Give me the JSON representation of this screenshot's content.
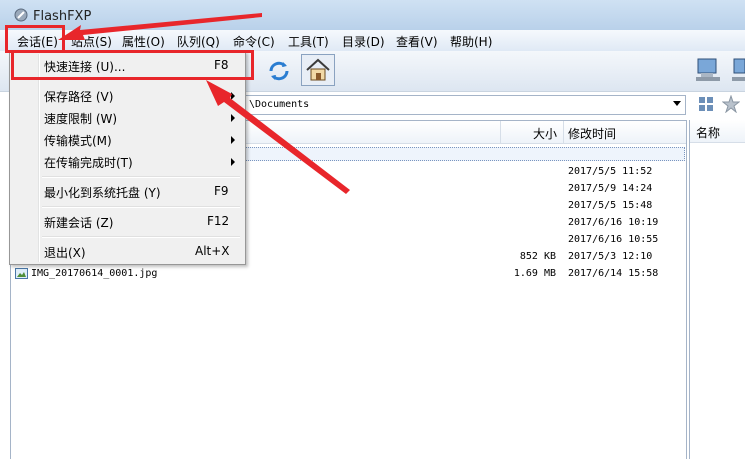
{
  "app": {
    "title": "FlashFXP"
  },
  "menubar": [
    "会话(E)",
    "站点(S)",
    "属性(O)",
    "队列(Q)",
    "命令(C)",
    "工具(T)",
    "目录(D)",
    "查看(V)",
    "帮助(H)"
  ],
  "path": {
    "value": "\\Documents"
  },
  "columns": {
    "size": "大小",
    "modified": "修改时间",
    "right_name": "名称"
  },
  "files": [
    {
      "name": "",
      "size": "",
      "time": "2017/5/5 11:52"
    },
    {
      "name": "",
      "size": "",
      "time": "2017/5/9 14:24"
    },
    {
      "name": "",
      "size": "",
      "time": "2017/5/5 15:48"
    },
    {
      "name": "",
      "size": "",
      "time": "2017/6/16 10:19"
    },
    {
      "name": "",
      "size": "",
      "time": "2017/6/16 10:55"
    },
    {
      "name": "",
      "size": "852 KB",
      "time": "2017/5/3 12:10"
    },
    {
      "name": "IMG_20170614_0001.jpg",
      "size": "1.69 MB",
      "time": "2017/6/14 15:58"
    }
  ],
  "menu": {
    "quick_connect": "快速连接 (U)...",
    "quick_connect_key": "F8",
    "save_path": "保存路径 (V)",
    "speed_limit": "速度限制 (W)",
    "transfer_mode": "传输模式(M)",
    "on_complete": "在传输完成时(T)",
    "minimize_tray": "最小化到系统托盘 (Y)",
    "minimize_tray_key": "F9",
    "new_session": "新建会话 (Z)",
    "new_session_key": "F12",
    "exit": "退出(X)",
    "exit_key": "Alt+X"
  },
  "colors": {
    "highlight": "#e8262b",
    "arrow": "#e8262b"
  }
}
